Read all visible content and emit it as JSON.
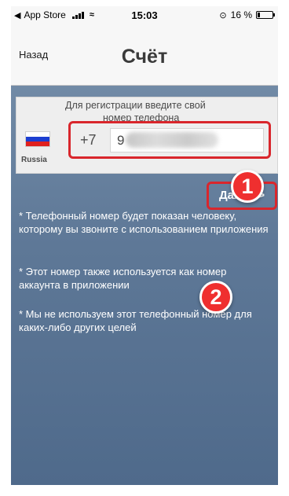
{
  "status_bar": {
    "back_app": "App Store",
    "time": "15:03",
    "battery_percent": "16 %",
    "battery_level": 0.16
  },
  "nav": {
    "back_label": "Назад",
    "title": "Счёт"
  },
  "form": {
    "instruction_line1": "Для регистрации введите свой",
    "instruction_line2": "номер телефона",
    "country": "Russia",
    "country_code": "+7",
    "phone_value": "9",
    "flag_colors": [
      "#ffffff",
      "#1c3fd1",
      "#e0211f"
    ]
  },
  "next_button": {
    "label": "Далее >"
  },
  "notes": [
    "* Телефонный номер будет показан человеку, которому вы звоните с использованием приложения",
    "* Этот номер также используется как номер аккаунта в приложении",
    "* Мы не используем этот телефонный номер для каких-либо других целей"
  ],
  "annotations": {
    "step1": "1",
    "step2": "2"
  },
  "colors": {
    "highlight_red": "#d9262c",
    "badge_red": "#ef2f2f",
    "content_bg": "#5e7897"
  }
}
